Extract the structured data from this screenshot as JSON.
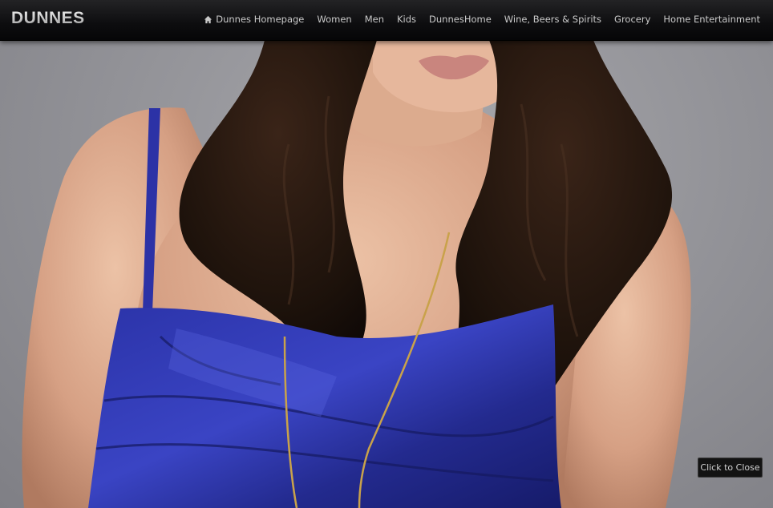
{
  "header": {
    "logo": "DUNNES",
    "nav": [
      {
        "label": "Dunnes Homepage",
        "icon": "home-icon"
      },
      {
        "label": "Women"
      },
      {
        "label": "Men"
      },
      {
        "label": "Kids"
      },
      {
        "label": "DunnesHome"
      },
      {
        "label": "Wine, Beers & Spirits"
      },
      {
        "label": "Grocery"
      },
      {
        "label": "Home Entertainment"
      }
    ]
  },
  "lightbox": {
    "close_label": "Click to Close"
  },
  "colors": {
    "topbar": "#0d0d0f",
    "nav_text": "#c9c9c9",
    "dress_blue": "#2a2f9a",
    "hair": "#1e120c",
    "skin": "#d9a58a",
    "backdrop": "#97979c"
  }
}
